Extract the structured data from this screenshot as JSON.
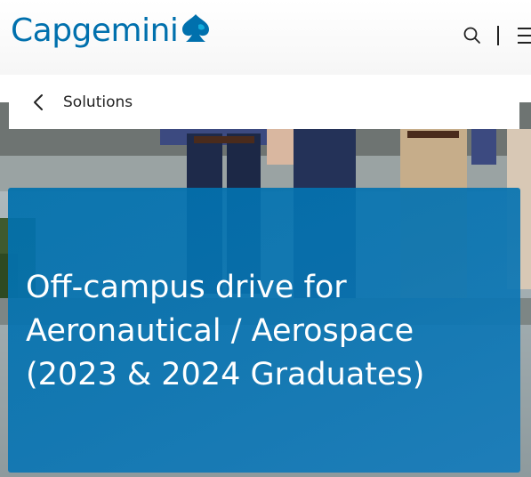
{
  "header": {
    "logo_text": "Capgemini",
    "icons": [
      "capgemini-spade-icon",
      "search-icon",
      "menu-icon"
    ]
  },
  "breadcrumb": {
    "label": "Solutions",
    "icon": "chevron-left-icon"
  },
  "hero": {
    "title_line1": "Off-campus drive for",
    "title_line2": "Aeronautical / Aerospace",
    "title_line3": "(2023 & 2024 Graduates)"
  },
  "colors": {
    "brand_blue": "#0070ad",
    "banner_blue": "#0b74b4",
    "breadcrumb_bg": "#ffffff",
    "text_dark": "#222222",
    "title_text": "#ffffff"
  }
}
